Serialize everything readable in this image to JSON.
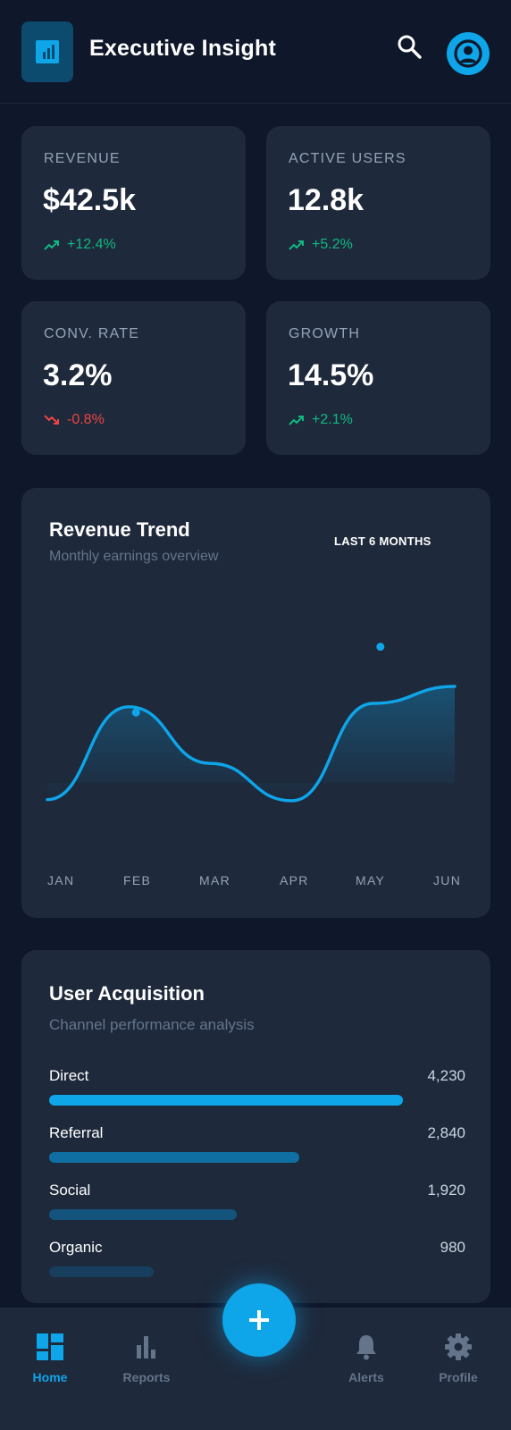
{
  "header": {
    "title": "Executive Insight",
    "logo_icon": "bar-chart-icon",
    "search_icon": "search-icon",
    "avatar_icon": "user-circle-icon"
  },
  "stats": [
    {
      "label": "REVENUE",
      "value": "$42.5k",
      "delta": "+12.4%",
      "trend": "up"
    },
    {
      "label": "ACTIVE USERS",
      "value": "12.8k",
      "delta": "+5.2%",
      "trend": "up"
    },
    {
      "label": "CONV. RATE",
      "value": "3.2%",
      "delta": "-0.8%",
      "trend": "down"
    },
    {
      "label": "GROWTH",
      "value": "14.5%",
      "delta": "+2.1%",
      "trend": "up"
    }
  ],
  "revenue_chart": {
    "title": "Revenue Trend",
    "subtitle": "Monthly earnings overview",
    "range_label": "LAST 6 MONTHS"
  },
  "chart_data": {
    "type": "area",
    "title": "Revenue Trend",
    "subtitle": "Monthly earnings overview",
    "categories": [
      "JAN",
      "FEB",
      "MAR",
      "APR",
      "MAY",
      "JUN"
    ],
    "values": [
      0.1,
      0.92,
      0.42,
      0.09,
      0.95,
      1.1
    ],
    "highlight_points": [
      {
        "x": "FEB",
        "y": 0.87
      },
      {
        "x": "MAY",
        "y": 1.45
      }
    ],
    "ylim": [
      -0.4,
      2.3
    ],
    "grid": false,
    "color": "#0ea5e9"
  },
  "acquisition": {
    "title": "User Acquisition",
    "subtitle": "Channel performance analysis",
    "channels": [
      {
        "name": "Direct",
        "value": "4,230",
        "fraction": 0.85,
        "color": "#0ea5e9"
      },
      {
        "name": "Referral",
        "value": "2,840",
        "fraction": 0.6,
        "color": "#0f6fa3"
      },
      {
        "name": "Social",
        "value": "1,920",
        "fraction": 0.45,
        "color": "#14547c"
      },
      {
        "name": "Organic",
        "value": "980",
        "fraction": 0.25,
        "color": "#173e5c"
      }
    ]
  },
  "nav": {
    "items": [
      {
        "label": "Home",
        "icon": "dashboard-icon",
        "active": true
      },
      {
        "label": "Reports",
        "icon": "bar-chart-icon",
        "active": false
      },
      {
        "label": "Alerts",
        "icon": "bell-icon",
        "active": false
      },
      {
        "label": "Profile",
        "icon": "gear-icon",
        "active": false
      }
    ],
    "fab_icon": "plus-icon"
  },
  "colors": {
    "background": "#0f172a",
    "card": "#1e293b",
    "accent": "#0ea5e9",
    "positive": "#10b981",
    "negative": "#ef4444"
  }
}
